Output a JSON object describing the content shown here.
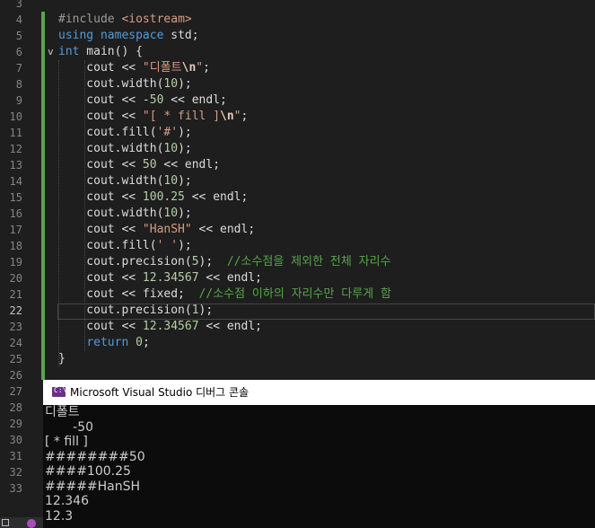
{
  "editor": {
    "lines": [
      {
        "n": "3",
        "segs": []
      },
      {
        "n": "4",
        "segs": [
          {
            "c": "prep",
            "t": "#include "
          },
          {
            "c": "str",
            "t": "<iostream>"
          }
        ]
      },
      {
        "n": "5",
        "segs": [
          {
            "c": "kw",
            "t": "using"
          },
          {
            "c": "",
            "t": " "
          },
          {
            "c": "kw",
            "t": "namespace"
          },
          {
            "c": "",
            "t": " std;"
          }
        ]
      },
      {
        "n": "6",
        "segs": [
          {
            "c": "kw",
            "t": "int"
          },
          {
            "c": "",
            "t": " main() {"
          }
        ]
      },
      {
        "n": "7",
        "segs": [
          {
            "c": "",
            "t": "    cout << "
          },
          {
            "c": "str",
            "t": "\"디폴트"
          },
          {
            "c": "esc",
            "t": "\\n"
          },
          {
            "c": "str",
            "t": "\""
          },
          {
            "c": "",
            "t": ";"
          }
        ]
      },
      {
        "n": "8",
        "segs": [
          {
            "c": "",
            "t": "    cout.width("
          },
          {
            "c": "num",
            "t": "10"
          },
          {
            "c": "",
            "t": ");"
          }
        ]
      },
      {
        "n": "9",
        "segs": [
          {
            "c": "",
            "t": "    cout << -"
          },
          {
            "c": "num",
            "t": "50"
          },
          {
            "c": "",
            "t": " << endl;"
          }
        ]
      },
      {
        "n": "10",
        "segs": [
          {
            "c": "",
            "t": "    cout << "
          },
          {
            "c": "str",
            "t": "\"[ * fill ]"
          },
          {
            "c": "esc",
            "t": "\\n"
          },
          {
            "c": "str",
            "t": "\""
          },
          {
            "c": "",
            "t": ";"
          }
        ]
      },
      {
        "n": "11",
        "segs": [
          {
            "c": "",
            "t": "    cout.fill("
          },
          {
            "c": "str",
            "t": "'#'"
          },
          {
            "c": "",
            "t": ");"
          }
        ]
      },
      {
        "n": "12",
        "segs": [
          {
            "c": "",
            "t": "    cout.width("
          },
          {
            "c": "num",
            "t": "10"
          },
          {
            "c": "",
            "t": ");"
          }
        ]
      },
      {
        "n": "13",
        "segs": [
          {
            "c": "",
            "t": "    cout << "
          },
          {
            "c": "num",
            "t": "50"
          },
          {
            "c": "",
            "t": " << endl;"
          }
        ]
      },
      {
        "n": "14",
        "segs": [
          {
            "c": "",
            "t": "    cout.width("
          },
          {
            "c": "num",
            "t": "10"
          },
          {
            "c": "",
            "t": ");"
          }
        ]
      },
      {
        "n": "15",
        "segs": [
          {
            "c": "",
            "t": "    cout << "
          },
          {
            "c": "num",
            "t": "100.25"
          },
          {
            "c": "",
            "t": " << endl;"
          }
        ]
      },
      {
        "n": "16",
        "segs": [
          {
            "c": "",
            "t": "    cout.width("
          },
          {
            "c": "num",
            "t": "10"
          },
          {
            "c": "",
            "t": ");"
          }
        ]
      },
      {
        "n": "17",
        "segs": [
          {
            "c": "",
            "t": "    cout << "
          },
          {
            "c": "str",
            "t": "\"HanSH\""
          },
          {
            "c": "",
            "t": " << endl;"
          }
        ]
      },
      {
        "n": "18",
        "segs": [
          {
            "c": "",
            "t": "    cout.fill("
          },
          {
            "c": "str",
            "t": "' '"
          },
          {
            "c": "",
            "t": ");"
          }
        ]
      },
      {
        "n": "19",
        "segs": [
          {
            "c": "",
            "t": "    cout.precision("
          },
          {
            "c": "num",
            "t": "5"
          },
          {
            "c": "",
            "t": ");  "
          },
          {
            "c": "cmt",
            "t": "//소수점을 제외한 전체 자리수"
          }
        ]
      },
      {
        "n": "20",
        "segs": [
          {
            "c": "",
            "t": "    cout << "
          },
          {
            "c": "num",
            "t": "12.34567"
          },
          {
            "c": "",
            "t": " << endl;"
          }
        ]
      },
      {
        "n": "21",
        "segs": [
          {
            "c": "",
            "t": "    cout << fixed;  "
          },
          {
            "c": "cmt",
            "t": "//소수점 이하의 자리수만 다루게 함"
          }
        ]
      },
      {
        "n": "22",
        "segs": [
          {
            "c": "",
            "t": "    cout.precision("
          },
          {
            "c": "num",
            "t": "1"
          },
          {
            "c": "",
            "t": ");"
          }
        ]
      },
      {
        "n": "23",
        "segs": [
          {
            "c": "",
            "t": "    cout << "
          },
          {
            "c": "num",
            "t": "12.34567"
          },
          {
            "c": "",
            "t": " << endl;"
          }
        ]
      },
      {
        "n": "24",
        "segs": [
          {
            "c": "",
            "t": "    "
          },
          {
            "c": "kw",
            "t": "return"
          },
          {
            "c": "",
            "t": " "
          },
          {
            "c": "num",
            "t": "0"
          },
          {
            "c": "",
            "t": ";"
          }
        ]
      },
      {
        "n": "25",
        "segs": [
          {
            "c": "",
            "t": "}"
          }
        ]
      },
      {
        "n": "26",
        "segs": []
      },
      {
        "n": "27",
        "segs": []
      },
      {
        "n": "28",
        "segs": []
      },
      {
        "n": "29",
        "segs": []
      },
      {
        "n": "30",
        "segs": []
      },
      {
        "n": "31",
        "segs": []
      },
      {
        "n": "32",
        "segs": []
      },
      {
        "n": "33",
        "segs": []
      }
    ],
    "active_line": "22",
    "fold_marker": "v"
  },
  "console": {
    "icon_label": "C:\\",
    "title": "Microsoft Visual Studio 디버그 콘솔",
    "output": [
      "디폴트",
      "       -50",
      "[ * fill ]",
      "########50",
      "####100.25",
      "#####HanSH",
      "12.346",
      "12.3"
    ]
  },
  "colors": {
    "background": "#1e1e1e",
    "keyword": "#569cd6",
    "string": "#d69d85",
    "number": "#b5cea8",
    "comment": "#57a64a",
    "change_bar": "#57a64a",
    "console_bg": "#0c0c0c",
    "console_text": "#cccccc"
  }
}
